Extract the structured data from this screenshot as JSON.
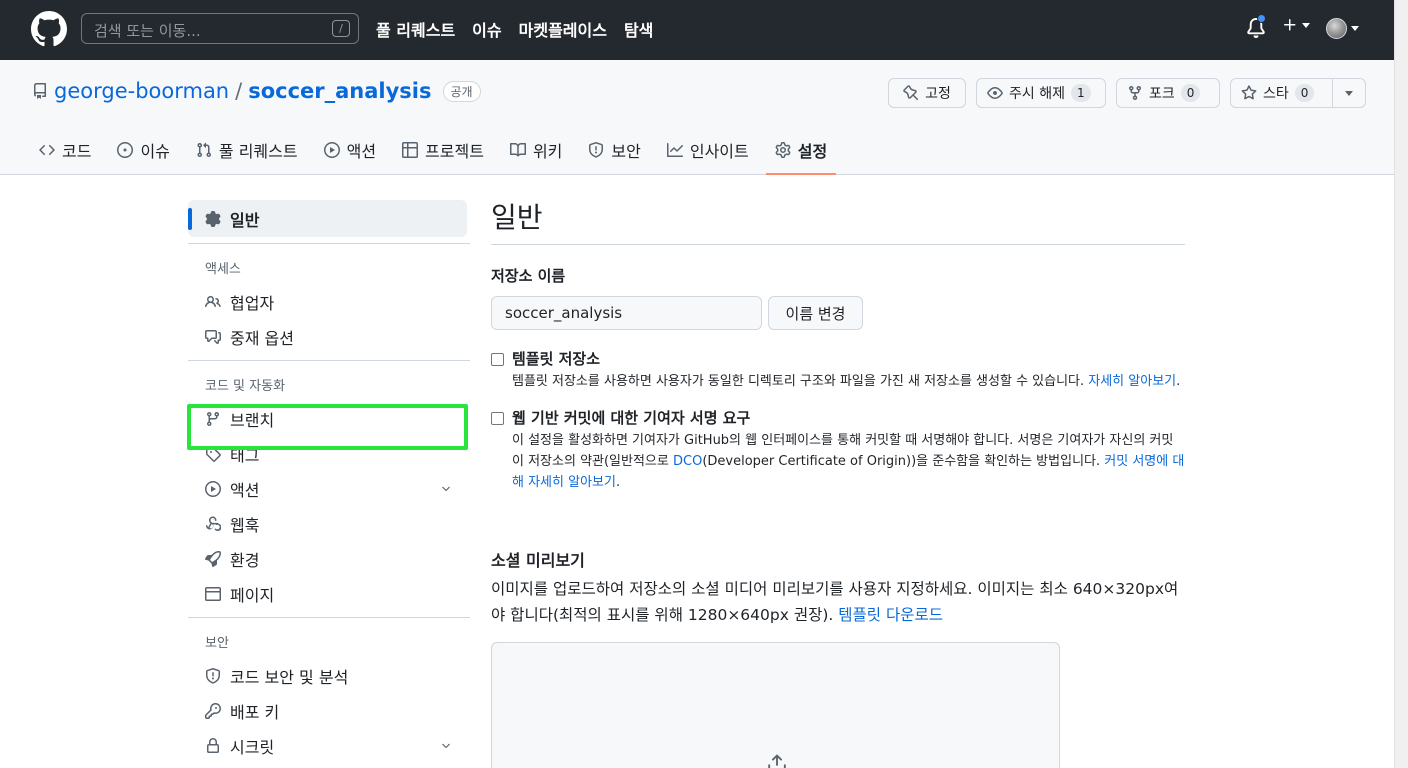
{
  "header": {
    "search_placeholder": "검색 또는 이동...",
    "search_shortcut": "/",
    "nav": [
      "풀 리퀘스트",
      "이슈",
      "마켓플레이스",
      "탐색"
    ],
    "icons": [
      "github-logo-icon",
      "bell-icon",
      "plus-icon",
      "avatar"
    ]
  },
  "repo": {
    "owner": "george-boorman",
    "separator": "/",
    "name": "soccer_analysis",
    "visibility": "공개",
    "actions": {
      "pin": "고정",
      "watch": "주시 해제",
      "watch_count": "1",
      "fork": "포크",
      "fork_count": "0",
      "star": "스타",
      "star_count": "0"
    },
    "tabs": [
      {
        "label": "코드",
        "icon": "code-icon"
      },
      {
        "label": "이슈",
        "icon": "issue-icon"
      },
      {
        "label": "풀 리퀘스트",
        "icon": "pull-request-icon"
      },
      {
        "label": "액션",
        "icon": "play-icon"
      },
      {
        "label": "프로젝트",
        "icon": "table-icon"
      },
      {
        "label": "위키",
        "icon": "book-icon"
      },
      {
        "label": "보안",
        "icon": "shield-icon"
      },
      {
        "label": "인사이트",
        "icon": "graph-icon"
      },
      {
        "label": "설정",
        "icon": "gear-icon"
      }
    ],
    "active_tab": "설정"
  },
  "sidebar": {
    "general": "일반",
    "access_heading": "액세스",
    "collaborators": "협업자",
    "moderation": "중재 옵션",
    "code_heading": "코드 및 자동화",
    "branches": "브랜치",
    "tags": "태그",
    "actions": "액션",
    "webhooks": "웹훅",
    "environments": "환경",
    "pages": "페이지",
    "security_heading": "보안",
    "code_security": "코드 보안 및 분석",
    "deploy_keys": "배포 키",
    "secrets": "시크릿",
    "highlight_color": "#27e53b"
  },
  "main": {
    "title": "일반",
    "repo_name_label": "저장소 이름",
    "repo_name_value": "soccer_analysis",
    "rename_button": "이름 변경",
    "template": {
      "title": "템플릿 저장소",
      "desc": "템플릿 저장소를 사용하면 사용자가 동일한 디렉토리 구조와 파일을 가진 새 저장소를 생성할 수 있습니다. ",
      "link": "자세히 알아보기",
      "end": "."
    },
    "signoff": {
      "title": "웹 기반 커밋에 대한 기여자 서명 요구",
      "desc1": "이 설정을 활성화하면 기여자가 GitHub의 웹 인터페이스를 통해 커밋할 때 서명해야 합니다. 서명은 기여자가 자신의 커밋이 저장소의 약관(일반적으로 ",
      "dco": "DCO",
      "desc2": "(Developer Certificate of Origin))을 준수함을 확인하는 방법입니다. ",
      "link": "커밋 서명에 대해 자세히 알아보기",
      "end": "."
    },
    "social": {
      "title": "소셜 미리보기",
      "desc": "이미지를 업로드하여 저장소의 소셜 미디어 미리보기를 사용자 지정하세요. 이미지는 최소 640×320px여야 합니다(최적의 표시를 위해 1280×640px 권장). ",
      "link": "템플릿 다운로드"
    }
  }
}
